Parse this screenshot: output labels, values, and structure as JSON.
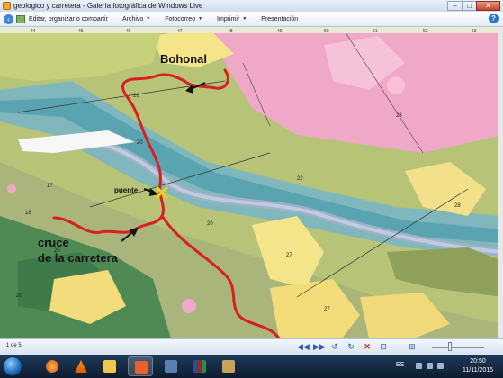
{
  "window": {
    "title": "geologico y carretera - Galería fotográfica de Windows Live",
    "buttons": [
      "–",
      "□",
      "✕"
    ]
  },
  "menu": {
    "back_icon": "back-arrow-icon",
    "items": [
      {
        "label": "Editar, organizar o compartir",
        "dropdown": false
      },
      {
        "label": "Archivo",
        "dropdown": true
      },
      {
        "label": "Fotocorreo",
        "dropdown": true
      },
      {
        "label": "Imprimir",
        "dropdown": true
      },
      {
        "label": "Presentación",
        "dropdown": false
      }
    ],
    "help_icon": "?"
  },
  "map": {
    "labels": {
      "bohonal": "Bohonal",
      "puente": "puente",
      "cruce_line1": "cruce",
      "cruce_line2": "de la carretera"
    },
    "grid_numbers": [
      "44",
      "45",
      "46",
      "47",
      "48",
      "49",
      "50",
      "51",
      "52",
      "53"
    ],
    "unit_codes": [
      "26",
      "20",
      "17",
      "20",
      "18",
      "27",
      "22",
      "23",
      "28",
      "27",
      "20",
      "26"
    ],
    "road_color": "#d92020"
  },
  "status": {
    "counter": "1 de 5",
    "controls": [
      "◀◀",
      "▶▶",
      "↺",
      "↻",
      "✕",
      "⊡",
      "⊞"
    ],
    "zoom_level": 0.35
  },
  "taskbar": {
    "apps": [
      "firefox-icon",
      "vlc-icon",
      "folder-icon",
      "photo-gallery-icon",
      "image-viewer-icon",
      "library-icon",
      "document-icon"
    ],
    "language": "ES",
    "time": "20:50",
    "date": "11/11/2015"
  }
}
